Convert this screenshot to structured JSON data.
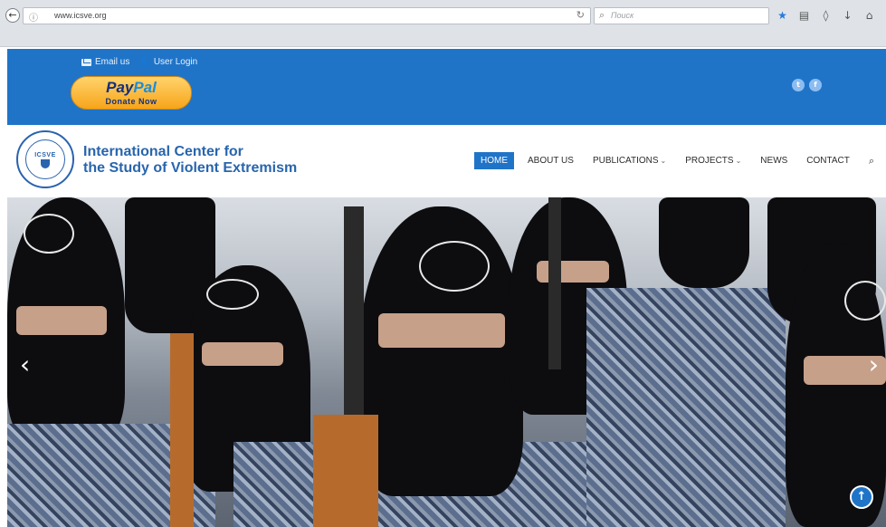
{
  "browser": {
    "url": "www.icsve.org",
    "search_placeholder": "Поиск"
  },
  "topbar": {
    "email_label": "Email us",
    "login_label": "User Login",
    "paypal": {
      "brand_dark": "Pay",
      "brand_light": "Pal",
      "sub": "Donate Now"
    },
    "social": [
      "twitter-icon",
      "facebook-icon"
    ]
  },
  "header": {
    "logo_text": "ICSVE",
    "site_name_line1": "International Center for",
    "site_name_line2": "the Study of Violent Extremism"
  },
  "nav": {
    "items": [
      {
        "label": "HOME",
        "active": true
      },
      {
        "label": "ABOUT US"
      },
      {
        "label": "PUBLICATIONS",
        "dropdown": true
      },
      {
        "label": "PROJECTS",
        "dropdown": true
      },
      {
        "label": "NEWS"
      },
      {
        "label": "CONTACT"
      }
    ]
  },
  "colors": {
    "brand_blue": "#1f74c8",
    "title_blue": "#2865ad"
  }
}
